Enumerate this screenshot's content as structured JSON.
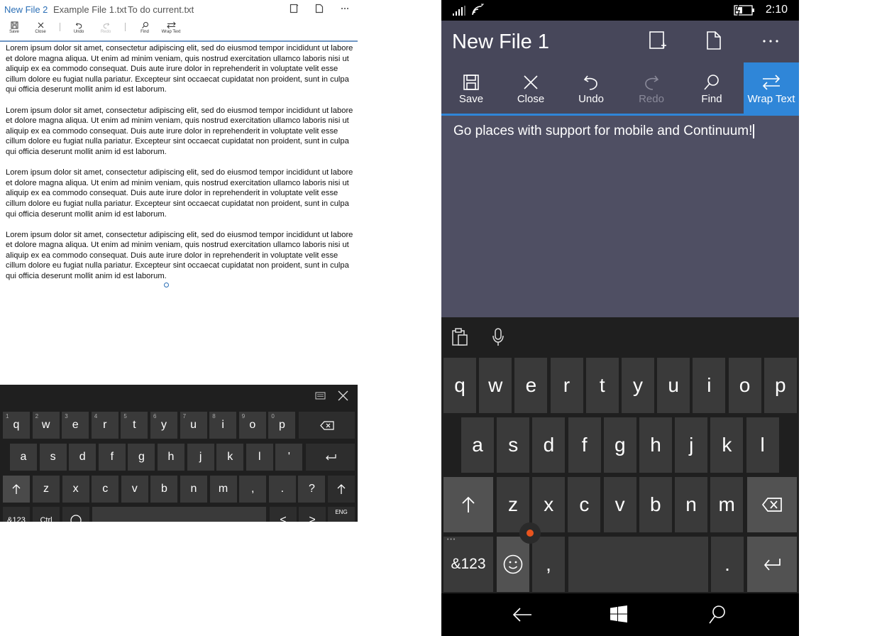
{
  "left_app": {
    "tabs": [
      "New File 2",
      "Example File 1.txt",
      "To do current.txt"
    ],
    "toolbar": {
      "save": "Save",
      "close": "Close",
      "undo": "Undo",
      "redo": "Redo",
      "find": "Find",
      "wrap_text": "Wrap Text"
    },
    "paragraphs": [
      "Lorem ipsum dolor sit amet, consectetur adipiscing elit, sed do eiusmod tempor incididunt ut labore et dolore magna aliqua. Ut enim ad minim veniam, quis nostrud exercitation ullamco laboris nisi ut aliquip ex ea commodo consequat. Duis aute irure dolor in reprehenderit in voluptate velit esse cillum dolore eu fugiat nulla pariatur. Excepteur sint occaecat cupidatat non proident, sunt in culpa qui officia deserunt mollit anim id est laborum.",
      "Lorem ipsum dolor sit amet, consectetur adipiscing elit, sed do eiusmod tempor incididunt ut labore et dolore magna aliqua. Ut enim ad minim veniam, quis nostrud exercitation ullamco laboris nisi ut aliquip ex ea commodo consequat. Duis aute irure dolor in reprehenderit in voluptate velit esse cillum dolore eu fugiat nulla pariatur. Excepteur sint occaecat cupidatat non proident, sunt in culpa qui officia deserunt mollit anim id est laborum.",
      "Lorem ipsum dolor sit amet, consectetur adipiscing elit, sed do eiusmod tempor incididunt ut labore et dolore magna aliqua. Ut enim ad minim veniam, quis nostrud exercitation ullamco laboris nisi ut aliquip ex ea commodo consequat. Duis aute irure dolor in reprehenderit in voluptate velit esse cillum dolore eu fugiat nulla pariatur. Excepteur sint occaecat cupidatat non proident, sunt in culpa qui officia deserunt mollit anim id est laborum.",
      "Lorem ipsum dolor sit amet, consectetur adipiscing elit, sed do eiusmod tempor incididunt ut labore et dolore magna aliqua. Ut enim ad minim veniam, quis nostrud exercitation ullamco laboris nisi ut aliquip ex ea commodo consequat. Duis aute irure dolor in reprehenderit in voluptate velit esse cillum dolore eu fugiat nulla pariatur. Excepteur sint occaecat cupidatat non proident, sunt in culpa qui officia deserunt mollit anim id est laborum."
    ],
    "keyboard": {
      "row1": [
        "q",
        "w",
        "e",
        "r",
        "t",
        "y",
        "u",
        "i",
        "o",
        "p"
      ],
      "row1_nums": [
        "1",
        "2",
        "3",
        "4",
        "5",
        "6",
        "7",
        "8",
        "9",
        "0"
      ],
      "row2": [
        "a",
        "s",
        "d",
        "f",
        "g",
        "h",
        "j",
        "k",
        "l",
        "'"
      ],
      "row3": [
        "z",
        "x",
        "c",
        "v",
        "b",
        "n",
        "m",
        ",",
        ".",
        "?"
      ],
      "symbols": "&123",
      "ctrl": "Ctrl",
      "lang": "ENG",
      "left_arrow": "<",
      "right_arrow": ">"
    }
  },
  "phone": {
    "time": "2:10",
    "title": "New File 1",
    "buttons": {
      "save": "Save",
      "close": "Close",
      "undo": "Undo",
      "redo": "Redo",
      "find": "Find",
      "wrap_text": "Wrap Text"
    },
    "editor_text": "Go places with support for mobile and Continuum!",
    "keyboard": {
      "row1": [
        "q",
        "w",
        "e",
        "r",
        "t",
        "y",
        "u",
        "i",
        "o",
        "p"
      ],
      "row2": [
        "a",
        "s",
        "d",
        "f",
        "g",
        "h",
        "j",
        "k",
        "l"
      ],
      "row3": [
        "z",
        "x",
        "c",
        "v",
        "b",
        "n",
        "m"
      ],
      "symbols": "&123",
      "comma": ",",
      "period": "."
    }
  },
  "colors": {
    "accent": "#2f86d8",
    "left_accent": "#6f96c4",
    "phone_appbar": "#47475a",
    "phone_editor": "#4f4f63",
    "keyboard_bg": "#1f1f1f",
    "key": "#3a3a3a"
  },
  "icons": [
    "save-icon",
    "close-icon",
    "undo-icon",
    "redo-icon",
    "find-icon",
    "wrap-text-icon",
    "tablet-mode-icon",
    "new-file-icon",
    "more-icon",
    "backspace-icon",
    "enter-icon",
    "shift-icon",
    "emoji-icon",
    "clipboard-icon",
    "microphone-icon",
    "back-icon",
    "windows-icon",
    "search-icon",
    "signal-icon",
    "wifi-icon",
    "battery-icon",
    "keyboard-icon"
  ]
}
